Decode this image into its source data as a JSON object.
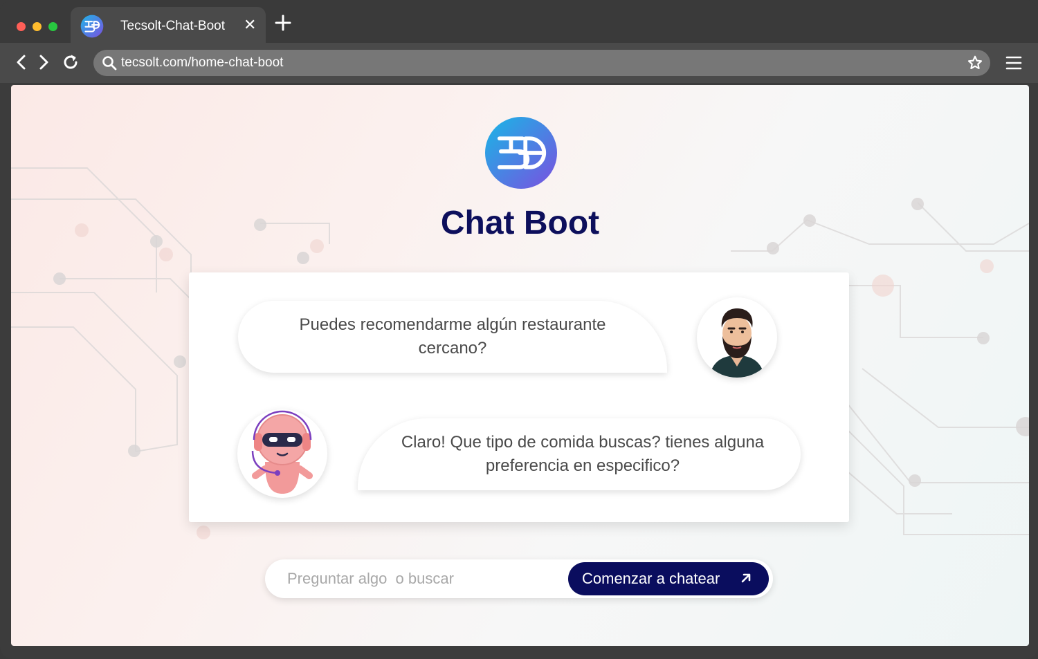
{
  "browser": {
    "tab": {
      "title": "Tecsolt-Chat-Boot",
      "favicon": "tecsolt-logo-icon"
    },
    "address": {
      "url": "tecsolt.com/home-chat-boot"
    },
    "icons": [
      "back-icon",
      "forward-icon",
      "reload-icon",
      "search-icon",
      "star-icon",
      "menu-icon",
      "close-icon",
      "plus-icon"
    ]
  },
  "page": {
    "title": "Chat Boot",
    "logo": "tecsolt-logo-icon"
  },
  "chat": {
    "messages": [
      {
        "sender": "user",
        "text": "Puedes recomendarme algún restaurante cercano?",
        "avatar": "bearded-man-avatar"
      },
      {
        "sender": "bot",
        "text": "Claro! Que tipo de comida buscas? tienes alguna preferencia en especifico?",
        "avatar": "robot-avatar"
      }
    ]
  },
  "search": {
    "placeholder": "Preguntar algo  o buscar",
    "value": "",
    "button_label": "Comenzar a chatear",
    "button_icon": "arrow-up-right-icon"
  },
  "colors": {
    "brand_navy": "#0a0d5e",
    "logo_gradient": [
      "#1fb6e8",
      "#7b4fe0"
    ],
    "bot_pink": "#f28b8b",
    "window_frame": "#3c3c3c"
  }
}
